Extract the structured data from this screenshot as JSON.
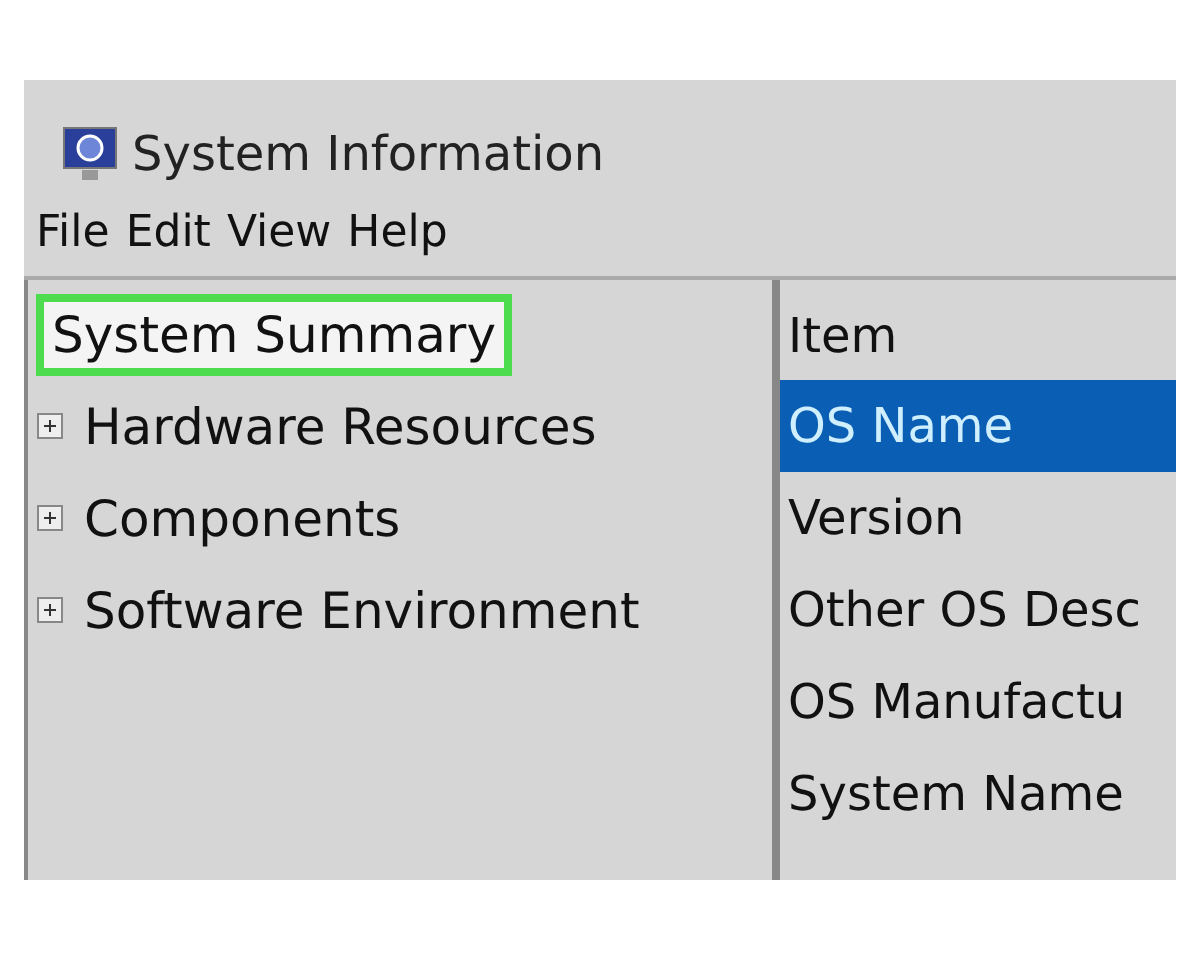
{
  "window": {
    "title": "System Information"
  },
  "menu": [
    "File",
    "Edit",
    "View",
    "Help"
  ],
  "tree": [
    {
      "label": "System Summary",
      "expandable": false,
      "highlighted": true
    },
    {
      "label": "Hardware Resources",
      "expandable": true,
      "highlighted": false
    },
    {
      "label": "Components",
      "expandable": true,
      "highlighted": false
    },
    {
      "label": "Software Environment",
      "expandable": true,
      "highlighted": false
    }
  ],
  "list": {
    "column": "Item",
    "rows": [
      {
        "label": "OS Name",
        "selected": true
      },
      {
        "label": "Version",
        "selected": false
      },
      {
        "label": "Other OS Desc",
        "selected": false
      },
      {
        "label": "OS Manufactu",
        "selected": false
      },
      {
        "label": "System Name",
        "selected": false
      }
    ]
  }
}
